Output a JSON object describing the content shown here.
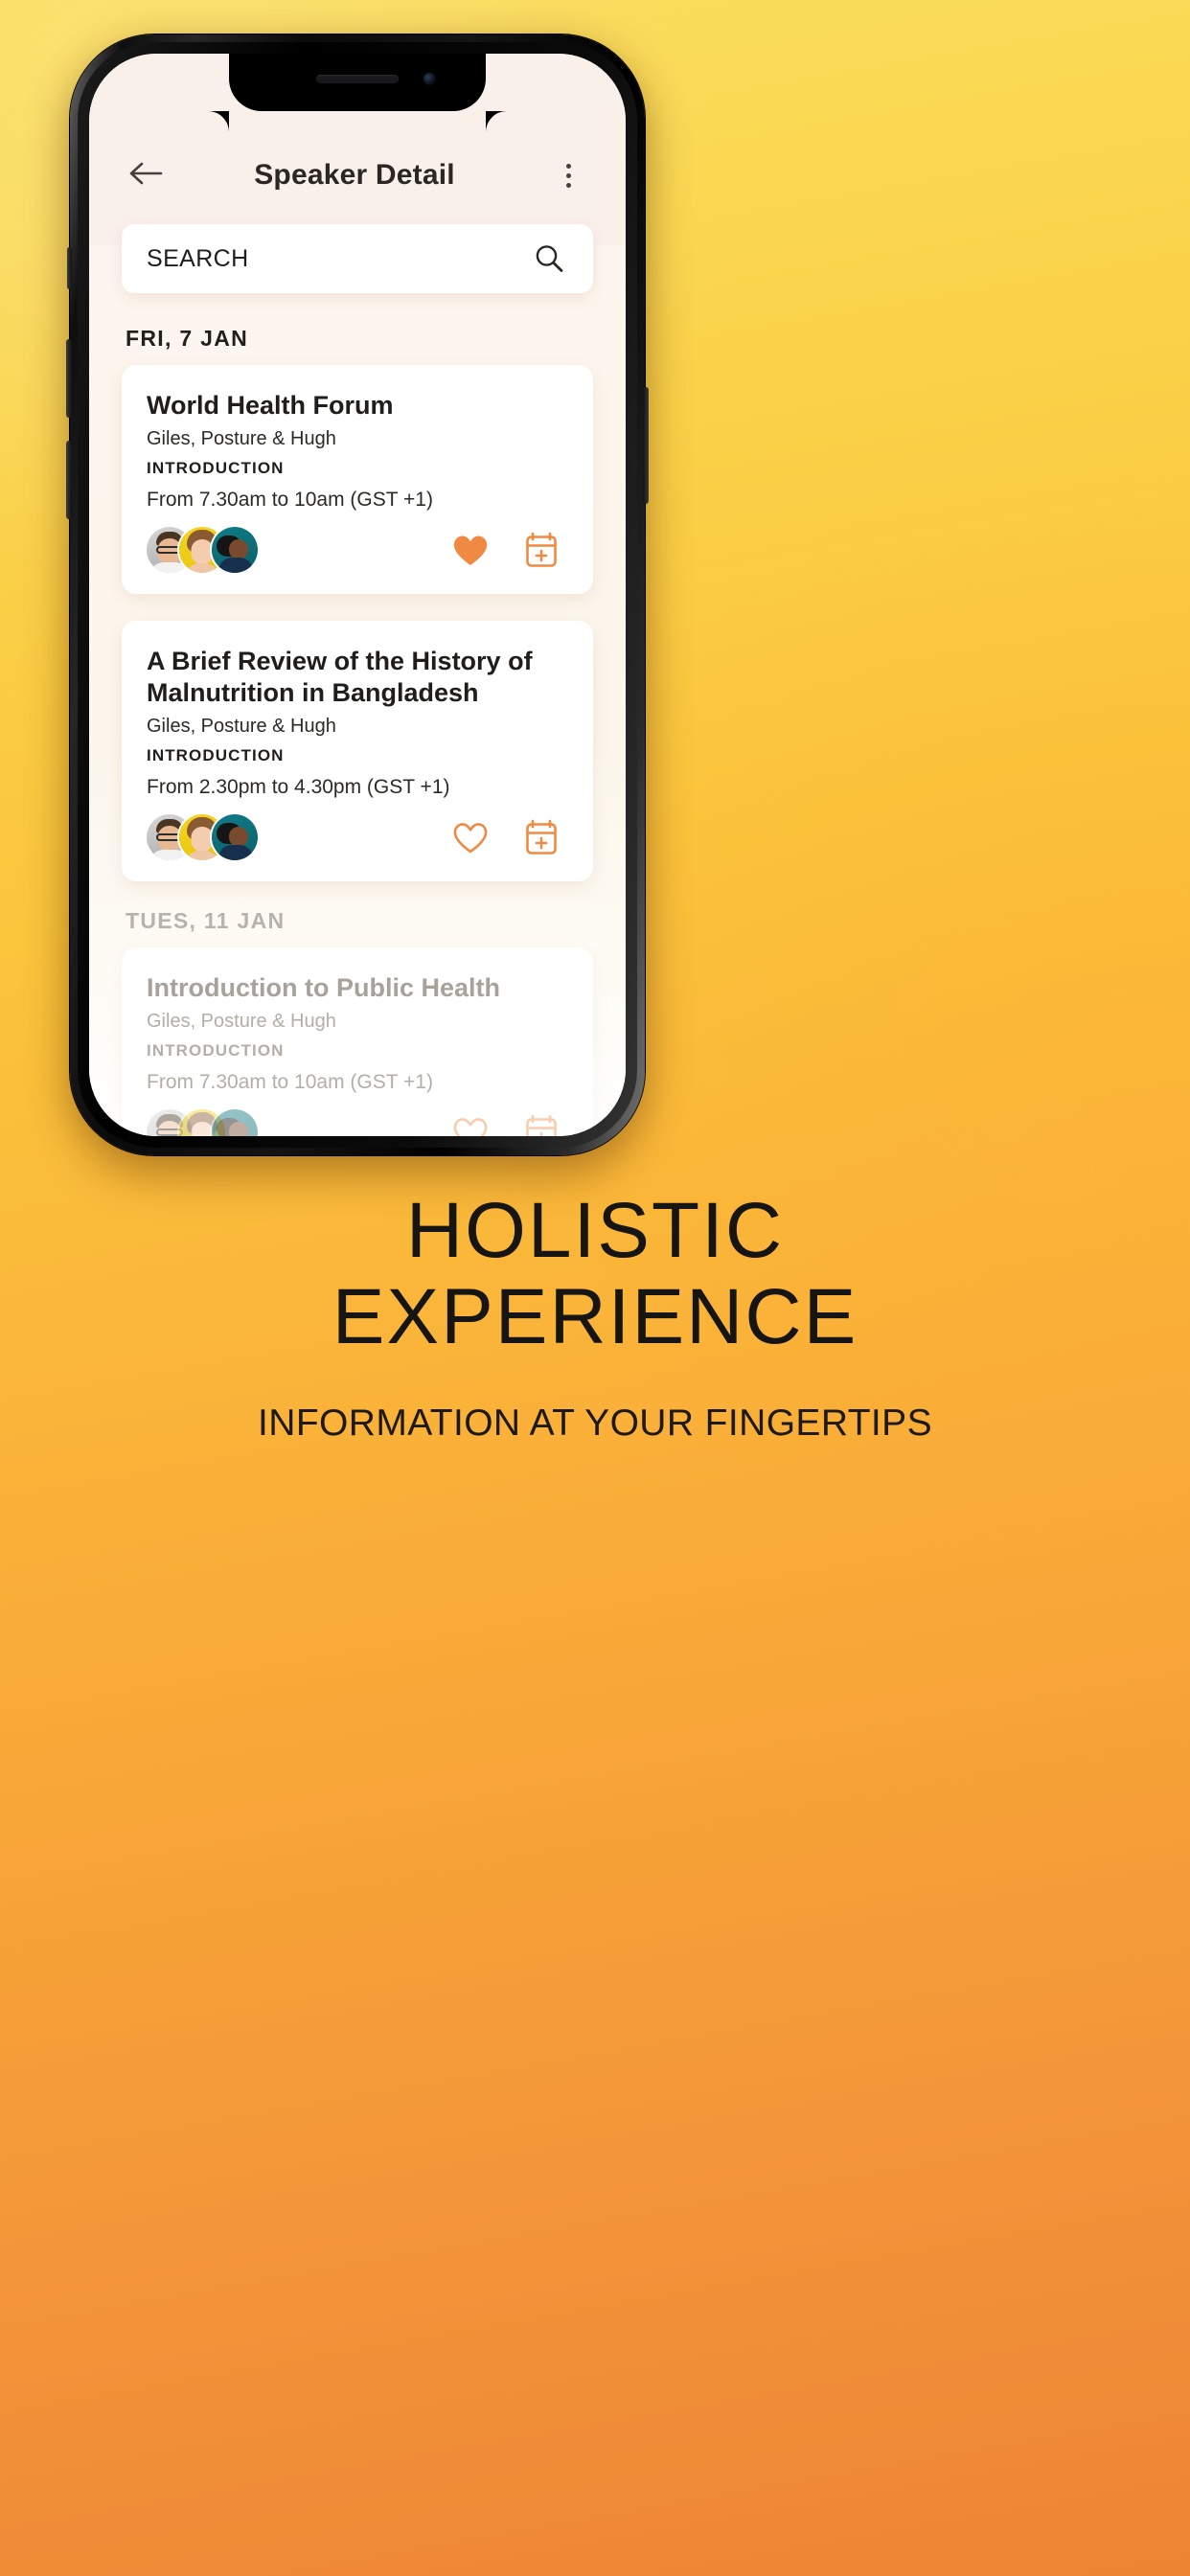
{
  "app": {
    "header": {
      "back_icon": "arrow-left-icon",
      "title": "Speaker Detail",
      "menu_icon": "kebab-menu-icon"
    },
    "search": {
      "placeholder": "SEARCH",
      "value": "",
      "icon": "search-icon"
    },
    "sections": [
      {
        "date_label": "FRI, 7 JAN",
        "dim": false,
        "events": [
          {
            "title": "World Health Forum",
            "speakers": "Giles, Posture & Hugh",
            "tag": "INTRODUCTION",
            "time": "From 7.30am to 10am (GST +1)",
            "favorited": true,
            "heart_icon": "heart-filled-icon",
            "calendar_icon": "calendar-plus-icon",
            "attendees": [
              "avatar-man-glasses",
              "avatar-woman-yellow",
              "avatar-person-teal"
            ]
          },
          {
            "title": "A Brief Review of the History of Malnutrition in Bangladesh",
            "speakers": "Giles, Posture & Hugh",
            "tag": "INTRODUCTION",
            "time": "From 2.30pm to 4.30pm (GST +1)",
            "favorited": false,
            "heart_icon": "heart-outline-icon",
            "calendar_icon": "calendar-plus-icon",
            "attendees": [
              "avatar-man-glasses",
              "avatar-woman-yellow",
              "avatar-person-teal"
            ]
          }
        ]
      },
      {
        "date_label": "TUES, 11 JAN",
        "dim": true,
        "events": [
          {
            "title": "Introduction to Public Health",
            "speakers": "Giles, Posture & Hugh",
            "tag": "INTRODUCTION",
            "time": "From 7.30am to 10am (GST +1)",
            "favorited": false,
            "heart_icon": "heart-outline-icon",
            "calendar_icon": "calendar-plus-icon",
            "attendees": [
              "avatar-man-glasses",
              "avatar-woman-yellow",
              "avatar-person-teal"
            ]
          }
        ]
      }
    ]
  },
  "promo": {
    "line1": "HOLISTIC",
    "line2": "EXPERIENCE",
    "subtitle": "INFORMATION AT YOUR FINGERTIPS"
  },
  "colors": {
    "accent": "#F08A42",
    "bg_top": "#FBDF62",
    "bg_bottom": "#ED8434",
    "screen_header": "#FAF0EA",
    "text": "#201D1A"
  }
}
